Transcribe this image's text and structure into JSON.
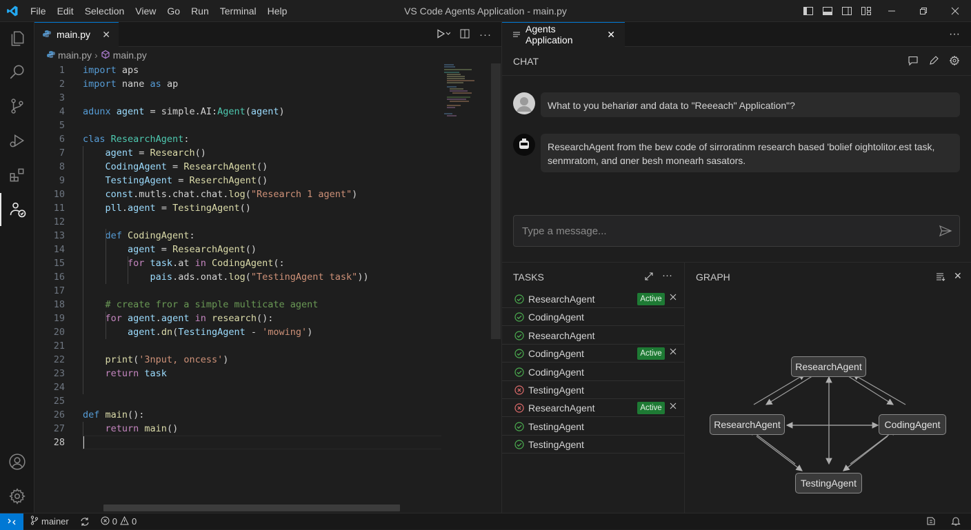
{
  "titlebar": {
    "menu": [
      "File",
      "Edit",
      "Selection",
      "View",
      "Go",
      "Run",
      "Terminal",
      "Help"
    ],
    "title": "VS Code Agents Application - main.py"
  },
  "editor": {
    "tab_label": "main.py",
    "breadcrumb": [
      "main.py",
      "main.py"
    ],
    "active_line": 28,
    "lines": [
      {
        "n": "1",
        "parts": [
          [
            "kw",
            "import "
          ],
          [
            "pl",
            "aps"
          ]
        ]
      },
      {
        "n": "2",
        "parts": [
          [
            "kw",
            "import "
          ],
          [
            "pl",
            "nane "
          ],
          [
            "kw",
            "as "
          ],
          [
            "pl",
            "ap"
          ]
        ]
      },
      {
        "n": "3",
        "parts": []
      },
      {
        "n": "4",
        "parts": [
          [
            "kw",
            "adunx "
          ],
          [
            "vr",
            "agent"
          ],
          [
            "pl",
            " = simple.AI:"
          ],
          [
            "cl",
            "Agent"
          ],
          [
            "pl",
            "("
          ],
          [
            "vr",
            "agent"
          ],
          [
            "pl",
            ")"
          ]
        ]
      },
      {
        "n": "5",
        "parts": []
      },
      {
        "n": "6",
        "parts": [
          [
            "kw",
            "clas "
          ],
          [
            "cl",
            "ResearchAgent"
          ],
          [
            "pl",
            ":"
          ]
        ]
      },
      {
        "n": "7",
        "parts": [
          [
            "pl",
            "    "
          ],
          [
            "vr",
            "agent"
          ],
          [
            "pl",
            " = "
          ],
          [
            "fn",
            "Research"
          ],
          [
            "pl",
            "()"
          ]
        ]
      },
      {
        "n": "8",
        "parts": [
          [
            "pl",
            "    "
          ],
          [
            "vr",
            "CodingAgent"
          ],
          [
            "pl",
            " = "
          ],
          [
            "fn",
            "ResearchAgent"
          ],
          [
            "pl",
            "()"
          ]
        ]
      },
      {
        "n": "9",
        "parts": [
          [
            "pl",
            "    "
          ],
          [
            "vr",
            "TestingAgent"
          ],
          [
            "pl",
            " = "
          ],
          [
            "fn",
            "ReserchAgent"
          ],
          [
            "pl",
            "()"
          ]
        ]
      },
      {
        "n": "10",
        "parts": [
          [
            "pl",
            "    "
          ],
          [
            "vr",
            "const"
          ],
          [
            "pl",
            ".mutls.chat.chat."
          ],
          [
            "fn",
            "log"
          ],
          [
            "pl",
            "("
          ],
          [
            "st",
            "\"Research 1 agent\""
          ],
          [
            "pl",
            ")"
          ]
        ]
      },
      {
        "n": "11",
        "parts": [
          [
            "pl",
            "    "
          ],
          [
            "vr",
            "pll"
          ],
          [
            "pl",
            "."
          ],
          [
            "vr",
            "agent"
          ],
          [
            "pl",
            " = "
          ],
          [
            "fn",
            "TestingAgent"
          ],
          [
            "pl",
            "()"
          ]
        ]
      },
      {
        "n": "12",
        "parts": []
      },
      {
        "n": "13",
        "parts": [
          [
            "pl",
            "    "
          ],
          [
            "kw",
            "def "
          ],
          [
            "fn",
            "CodingAgent"
          ],
          [
            "pl",
            ":"
          ]
        ]
      },
      {
        "n": "14",
        "parts": [
          [
            "pl",
            "        "
          ],
          [
            "vr",
            "agent"
          ],
          [
            "pl",
            " = "
          ],
          [
            "fn",
            "ResearchAgent"
          ],
          [
            "pl",
            "()"
          ]
        ]
      },
      {
        "n": "15",
        "parts": [
          [
            "pl",
            "        "
          ],
          [
            "ctl",
            "for "
          ],
          [
            "vr",
            "task"
          ],
          [
            "pl",
            ".at "
          ],
          [
            "ctl",
            "in "
          ],
          [
            "fn",
            "CodingAgent"
          ],
          [
            "pl",
            "(:"
          ]
        ]
      },
      {
        "n": "16",
        "parts": [
          [
            "pl",
            "            "
          ],
          [
            "vr",
            "pais"
          ],
          [
            "pl",
            ".ads.onat."
          ],
          [
            "fn",
            "log"
          ],
          [
            "pl",
            "("
          ],
          [
            "st",
            "\"TestingAgent task\""
          ],
          [
            "pl",
            "))"
          ]
        ]
      },
      {
        "n": "17",
        "parts": []
      },
      {
        "n": "18",
        "parts": [
          [
            "pl",
            "    "
          ],
          [
            "cm",
            "# create fror a simple multicate agent"
          ]
        ]
      },
      {
        "n": "19",
        "parts": [
          [
            "pl",
            "    "
          ],
          [
            "ctl",
            "for "
          ],
          [
            "vr",
            "agent"
          ],
          [
            "pl",
            "."
          ],
          [
            "vr",
            "agent"
          ],
          [
            "ctl",
            " in "
          ],
          [
            "fn",
            "research"
          ],
          [
            "pl",
            "():"
          ]
        ]
      },
      {
        "n": "20",
        "parts": [
          [
            "pl",
            "        "
          ],
          [
            "vr",
            "agent"
          ],
          [
            "pl",
            "."
          ],
          [
            "fn",
            "dn"
          ],
          [
            "pl",
            "("
          ],
          [
            "vr",
            "TestingAgent"
          ],
          [
            "pl",
            " - "
          ],
          [
            "st",
            "'mowing'"
          ],
          [
            "pl",
            ")"
          ]
        ]
      },
      {
        "n": "21",
        "parts": []
      },
      {
        "n": "22",
        "parts": [
          [
            "pl",
            "    "
          ],
          [
            "fn",
            "print"
          ],
          [
            "pl",
            "("
          ],
          [
            "st",
            "'3nput, oncess'"
          ],
          [
            "pl",
            ")"
          ]
        ]
      },
      {
        "n": "23",
        "parts": [
          [
            "pl",
            "    "
          ],
          [
            "ctl",
            "return "
          ],
          [
            "vr",
            "task"
          ]
        ]
      },
      {
        "n": "24",
        "parts": []
      },
      {
        "n": "25",
        "parts": []
      },
      {
        "n": "26",
        "parts": [
          [
            "kw",
            "def "
          ],
          [
            "fn",
            "main"
          ],
          [
            "pl",
            "():"
          ]
        ]
      },
      {
        "n": "27",
        "parts": [
          [
            "pl",
            "    "
          ],
          [
            "ctl",
            "return "
          ],
          [
            "fn",
            "main"
          ],
          [
            "pl",
            "()"
          ]
        ]
      },
      {
        "n": "28",
        "parts": []
      }
    ]
  },
  "agents_panel": {
    "tab_label": "Agents Application",
    "chat": {
      "title": "CHAT",
      "messages": [
        {
          "role": "user",
          "text": "What to you behariør and data to \"Reeeach\" Application\"?"
        },
        {
          "role": "agent",
          "text": "ResearchAgent from the bew code of sirroratinm research based 'bolief oightolitor.est task, senmratom, and ɑner besh monearh sasators."
        }
      ],
      "input_placeholder": "Type a message..."
    },
    "tasks": {
      "title": "TASKS",
      "items": [
        {
          "label": "ResearchAgent",
          "status": "success",
          "badge": "Active"
        },
        {
          "label": "CodingAgent",
          "status": "success",
          "badge": ""
        },
        {
          "label": "ResearchAgent",
          "status": "success",
          "badge": ""
        },
        {
          "label": "CodingAgent",
          "status": "success",
          "badge": "Active"
        },
        {
          "label": "CodingAgent",
          "status": "success",
          "badge": ""
        },
        {
          "label": "TestingAgent",
          "status": "error",
          "badge": ""
        },
        {
          "label": "ResearchAgent",
          "status": "error",
          "badge": "Active"
        },
        {
          "label": "TestingAgent",
          "status": "success",
          "badge": ""
        },
        {
          "label": "TestingAgent",
          "status": "success",
          "badge": ""
        }
      ]
    },
    "graph": {
      "title": "GRAPH",
      "nodes": {
        "top": "ResearchAgent",
        "left": "ResearchAgent",
        "right": "CodingAgent",
        "bottom": "TestingAgent"
      }
    }
  },
  "statusbar": {
    "branch": "mainer",
    "errors": "0",
    "warnings": "0"
  },
  "colors": {
    "accent": "#0078d4",
    "badge": "#1e7a34",
    "success": "#4caf50",
    "error": "#e06c6c"
  }
}
